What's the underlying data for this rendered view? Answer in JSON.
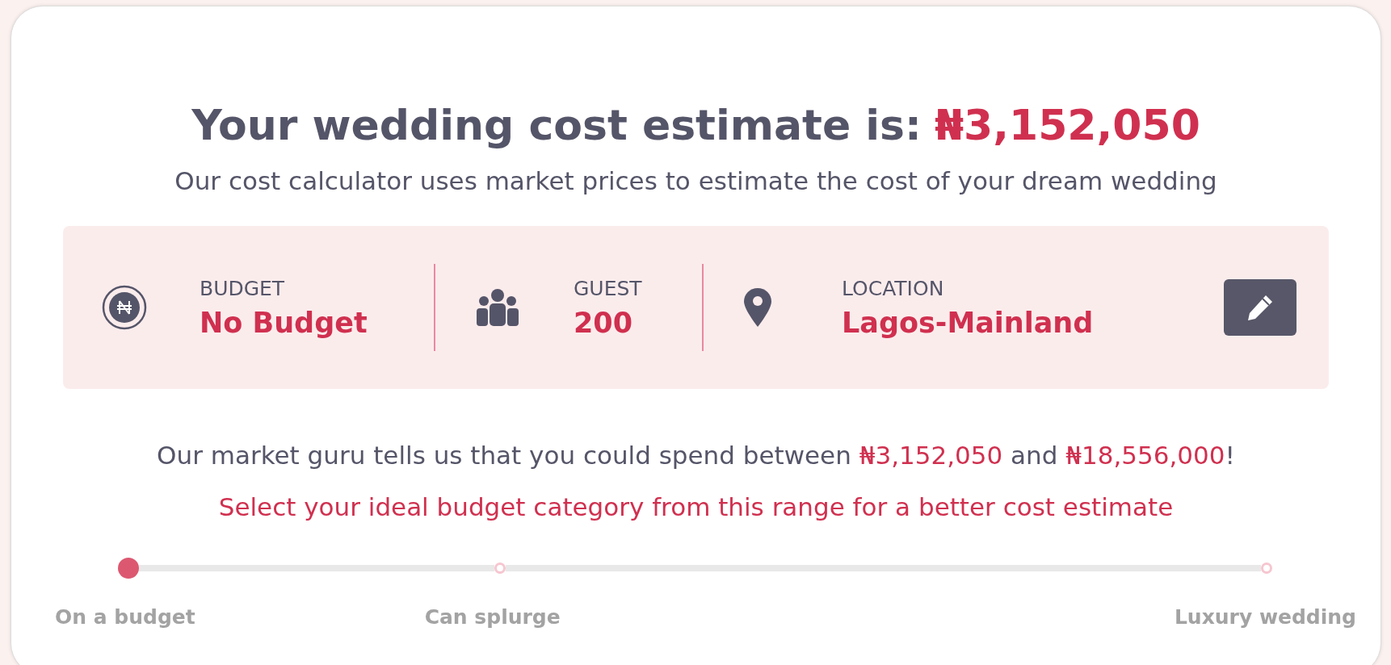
{
  "heading": {
    "text": "Your wedding cost estimate is:",
    "amount": "₦3,152,050"
  },
  "subtitle": "Our cost calculator uses market prices to estimate the cost of your dream wedding",
  "summary": {
    "items": [
      {
        "kind": "budget",
        "label": "BUDGET",
        "value": "No Budget"
      },
      {
        "kind": "guest",
        "label": "GUEST",
        "value": "200"
      },
      {
        "kind": "location",
        "label": "LOCATION",
        "value": "Lagos-Mainland"
      }
    ]
  },
  "range_sentence": [
    {
      "text": "Our market guru tells us that you could spend between ",
      "highlight": false
    },
    {
      "text": "₦3,152,050",
      "highlight": true
    },
    {
      "text": " and ",
      "highlight": false
    },
    {
      "text": "₦18,556,000",
      "highlight": true
    },
    {
      "text": "!",
      "highlight": false
    }
  ],
  "prompt": "Select your ideal budget category from this range for a better cost estimate",
  "budget_slider": {
    "stops": [
      {
        "label": "On a budget",
        "selected": true
      },
      {
        "label": "Can splurge",
        "selected": false
      },
      {
        "label": "Luxury wedding",
        "selected": false
      }
    ]
  }
}
